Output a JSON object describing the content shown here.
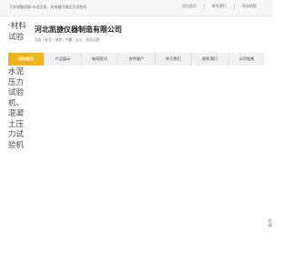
{
  "topbar": {
    "welcome": "大学电脑设备-水泥压机，应电器河南压力试验机",
    "links": [
      "设为首页",
      "联系我们",
      "网站地图"
    ]
  },
  "header": {
    "logo_alt": "材料试验",
    "company_name": "河北凯捷仪器制造有限公司",
    "slogan": "品质 / 安全 / 诚信 / 共赢 / 全心 · 优质品牌"
  },
  "nav": {
    "items": [
      "网站首页",
      "产品展示",
      "新闻资讯",
      "合作客户",
      "关于我们",
      "联系我们",
      "公司相册"
    ],
    "active_index": 0,
    "accent_color": "#f2b21e"
  },
  "banner": {
    "alt_text": "水泥压力试验机、混凝土压力试验机"
  },
  "side_widget": {
    "label": "在线"
  }
}
